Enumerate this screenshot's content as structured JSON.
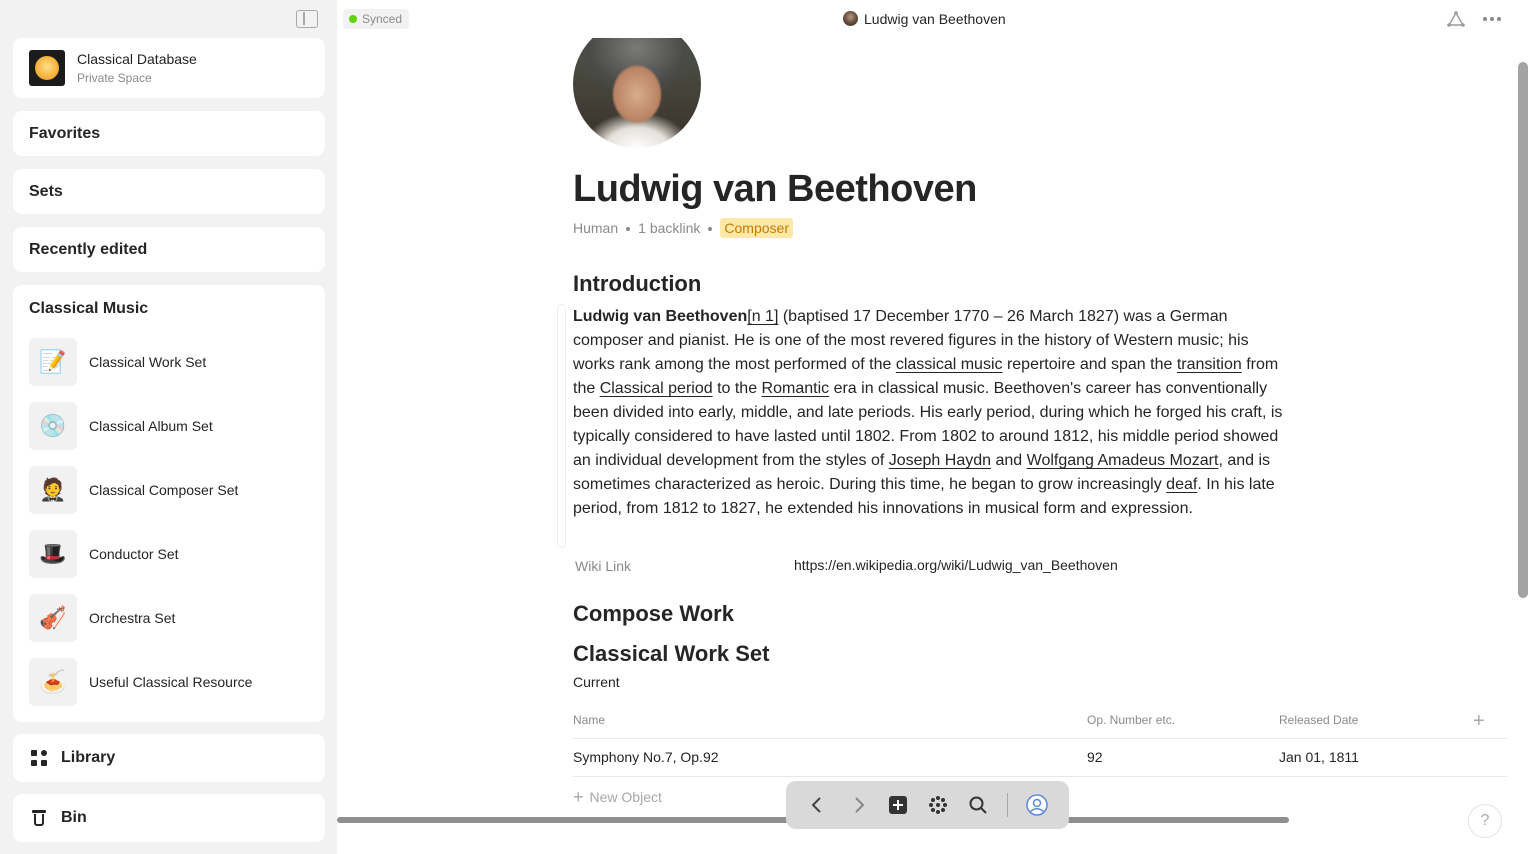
{
  "topbar": {
    "sync_status": "Synced",
    "object_title": "Ludwig van Beethoven"
  },
  "sidebar": {
    "space": {
      "name": "Classical Database",
      "type": "Private Space"
    },
    "widgets": {
      "favorites": "Favorites",
      "sets": "Sets",
      "recent": "Recently edited",
      "collection": {
        "title": "Classical Music",
        "items": [
          {
            "label": "Classical Work Set",
            "icon": "📝"
          },
          {
            "label": "Classical Album Set",
            "icon": "💿"
          },
          {
            "label": "Classical Composer Set",
            "icon": "🤵"
          },
          {
            "label": "Conductor Set",
            "icon": "🎩"
          },
          {
            "label": "Orchestra Set",
            "icon": "🎻"
          },
          {
            "label": "Useful Classical Resource",
            "icon": "🍝"
          }
        ]
      }
    },
    "library": "Library",
    "bin": "Bin"
  },
  "page": {
    "title": "Ludwig van Beethoven",
    "type": "Human",
    "backlinks": "1 backlink",
    "tag": "Composer",
    "intro_heading": "Introduction",
    "intro": {
      "name": "Ludwig van Beethoven",
      "note": "[n 1]",
      "t1": " (baptised 17 December 1770 – 26 March 1827) was a German composer and pianist. He is one of the most revered figures in the history of Western music; his works rank among the most performed of the ",
      "link_classical_music": "classical music",
      "t2": " repertoire and span the ",
      "link_transition": "transition",
      "t3": " from the ",
      "link_classical_period": "Classical period",
      "t4": " to the ",
      "link_romantic": "Romantic",
      "t5": " era in classical music. Beethoven's career has conventionally been divided into early, middle, and late periods. His early period, during which he forged his craft, is typically considered to have lasted until 1802. From 1802 to around 1812, his middle period showed an individual development from the styles of ",
      "link_haydn": "Joseph Haydn",
      "t6": " and ",
      "link_mozart": "Wolfgang Amadeus Mozart",
      "t7": ", and is sometimes characterized as heroic. During this time, he began to grow increasingly ",
      "link_deaf": "deaf",
      "t8": ". In his late period, from 1812 to 1827, he extended his innovations in musical form and expression."
    },
    "relation": {
      "label": "Wiki Link",
      "value": "https://en.wikipedia.org/wiki/Ludwig_van_Beethoven"
    },
    "compose_heading": "Compose Work",
    "set_block": {
      "title": "Classical Work Set",
      "view": "Current",
      "columns": [
        "Name",
        "Op. Number etc.",
        "Released Date"
      ],
      "rows": [
        {
          "name": "Symphony No.7, Op.92",
          "op": "92",
          "date": "Jan 01, 1811"
        }
      ],
      "new_object": "New Object"
    }
  },
  "help": "?"
}
